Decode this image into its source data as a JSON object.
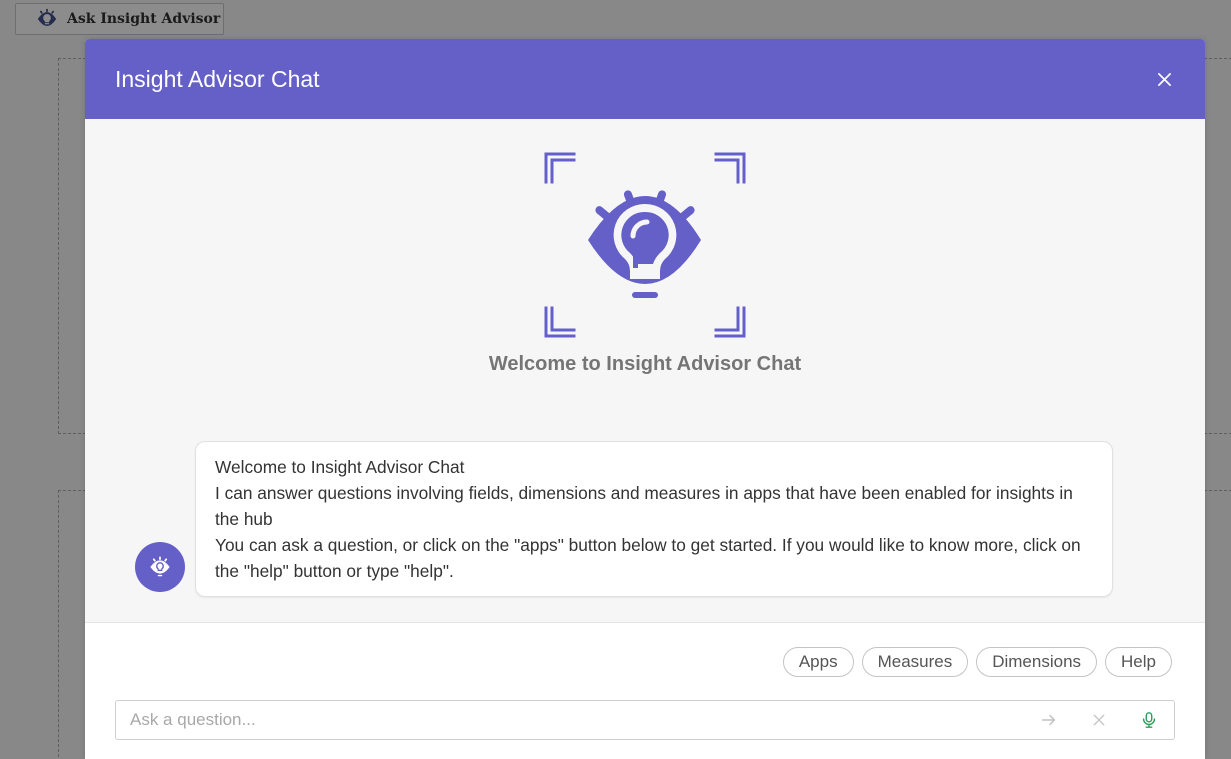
{
  "background": {
    "ask_button_label": "Ask Insight Advisor"
  },
  "modal": {
    "title": "Insight Advisor Chat",
    "welcome_heading": "Welcome to Insight Advisor Chat",
    "message_lines": [
      "Welcome to Insight Advisor Chat",
      "I can answer questions involving fields, dimensions and measures in apps that have been enabled for insights in the hub",
      "You can ask a question, or click on the \"apps\" button below to get started. If you would like to know more, click on the \"help\" button or type \"help\"."
    ],
    "quick_actions": [
      "Apps",
      "Measures",
      "Dimensions",
      "Help"
    ],
    "input": {
      "placeholder": "Ask a question...",
      "value": ""
    }
  },
  "colors": {
    "brand": "#6560c7",
    "mic": "#2e9e5b"
  },
  "icons": {
    "brand": "insight-advisor-eye-bulb-icon",
    "close": "close-icon",
    "send": "arrow-right-icon",
    "clear": "clear-x-icon",
    "mic": "microphone-icon"
  }
}
